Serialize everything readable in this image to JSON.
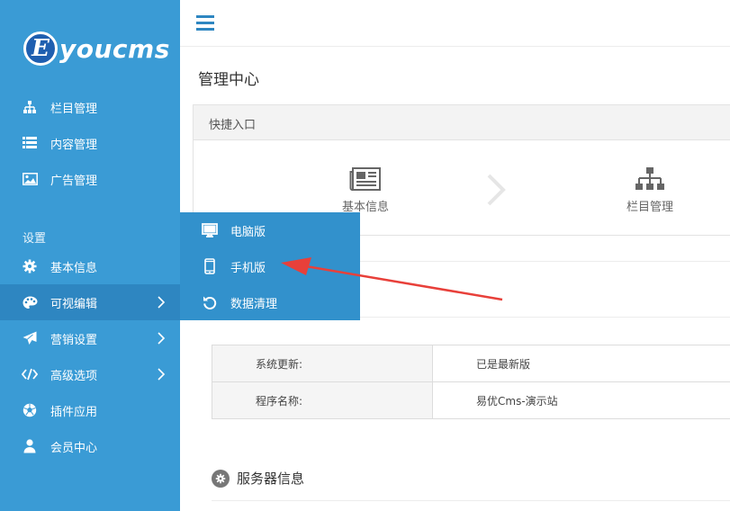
{
  "brand": {
    "logo_letter": "E",
    "logo_text": "youcms"
  },
  "sidebar": {
    "items_top": [
      {
        "label": "栏目管理",
        "icon": "sitemap-icon"
      },
      {
        "label": "内容管理",
        "icon": "list-icon"
      },
      {
        "label": "广告管理",
        "icon": "image-icon"
      }
    ],
    "section_label": "设置",
    "items_settings": [
      {
        "label": "基本信息",
        "icon": "gear-icon"
      },
      {
        "label": "可视编辑",
        "icon": "palette-icon",
        "has_submenu": true,
        "active": true
      },
      {
        "label": "营销设置",
        "icon": "paper-plane-icon",
        "has_submenu": true
      },
      {
        "label": "高级选项",
        "icon": "code-icon",
        "has_submenu": true
      },
      {
        "label": "插件应用",
        "icon": "soccer-icon"
      },
      {
        "label": "会员中心",
        "icon": "user-icon"
      }
    ]
  },
  "flyout": {
    "items": [
      {
        "label": "电脑版",
        "icon": "desktop-icon"
      },
      {
        "label": "手机版",
        "icon": "mobile-icon"
      },
      {
        "label": "数据清理",
        "icon": "undo-icon"
      }
    ]
  },
  "main": {
    "page_title": "管理中心",
    "quick_panel": {
      "title": "快捷入口",
      "items": [
        {
          "label": "基本信息",
          "icon": "newspaper-icon"
        },
        {
          "label": "栏目管理",
          "icon": "sitemap-icon"
        }
      ]
    },
    "info_rows": [
      {
        "key": "系统更新:",
        "value": "已是最新版"
      },
      {
        "key": "程序名称:",
        "value": "易优Cms-演示站"
      }
    ],
    "server_title": "服务器信息"
  },
  "colors": {
    "sidebar_bg": "#3a9bd5",
    "sidebar_active": "#2e86c1",
    "flyout_bg": "#3291cc",
    "annotation_arrow": "#e8403a"
  }
}
